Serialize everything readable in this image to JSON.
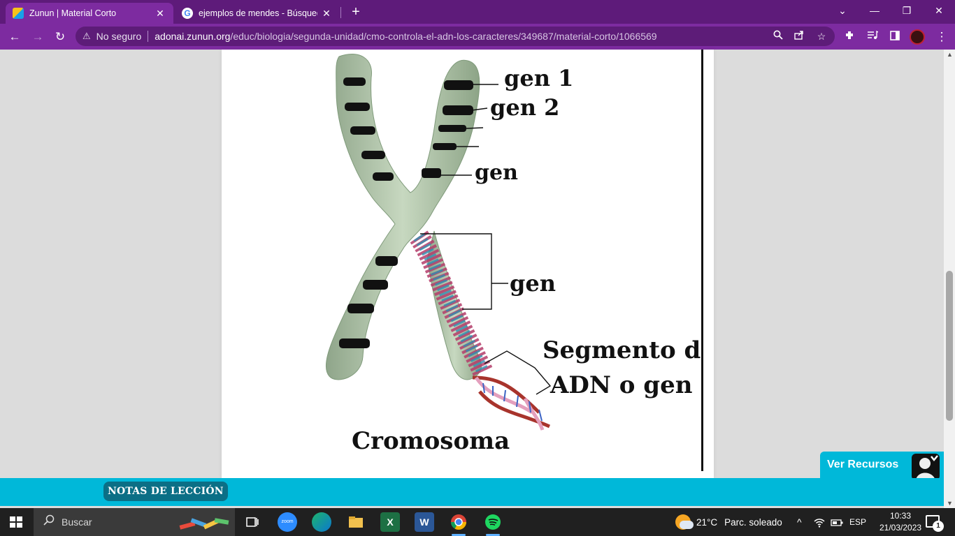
{
  "browser": {
    "tabs": [
      {
        "title": "Zunun | Material Corto",
        "favicon": "zunun-favicon",
        "active": true
      },
      {
        "title": "ejemplos de mendes - Búsqueda",
        "favicon": "google-favicon",
        "active": false
      }
    ],
    "new_tab": "+",
    "window_controls": {
      "dropdown": "⌄",
      "minimize": "—",
      "restore": "❐",
      "close": "✕"
    },
    "nav": {
      "back": "←",
      "forward": "→",
      "reload": "↻"
    },
    "address": {
      "security_icon": "⚠",
      "security_text": "No seguro",
      "domain": "adonai.zunun.org",
      "path": "/educ/biologia/segunda-unidad/cmo-controla-el-adn-los-caracteres/349687/material-corto/1066569"
    },
    "toolbar_icons": [
      "zoom-icon",
      "share-icon",
      "bookmark-star-icon",
      "extensions-icon",
      "media-icon",
      "side-panel-icon",
      "profile-avatar",
      "menu-icon"
    ],
    "accent_color": "#7d2ba0"
  },
  "figure": {
    "labels": {
      "gen1": "gen 1",
      "gen2": "gen 2",
      "gen_small": "gen",
      "gen_big": "gen",
      "segment_line1": "Segmento de",
      "segment_line2": "ADN o gen",
      "cromosoma": "Cromosoma"
    }
  },
  "lesson": {
    "notas_label": "NOTAS DE LECCIÓN",
    "ver_recursos": "Ver Recursos",
    "bar_color": "#00b8d9"
  },
  "taskbar": {
    "search_placeholder": "Buscar",
    "apps": [
      "task-view-icon",
      "zoom-app-icon",
      "edge-icon",
      "file-explorer-icon",
      "excel-icon",
      "word-icon",
      "chrome-icon",
      "spotify-icon"
    ],
    "weather": {
      "temp": "21°C",
      "condition": "Parc. soleado"
    },
    "tray": {
      "chevron": "^",
      "lang": "ESP"
    },
    "clock": {
      "time": "10:33",
      "date": "21/03/2023"
    },
    "notifications_count": "1"
  }
}
